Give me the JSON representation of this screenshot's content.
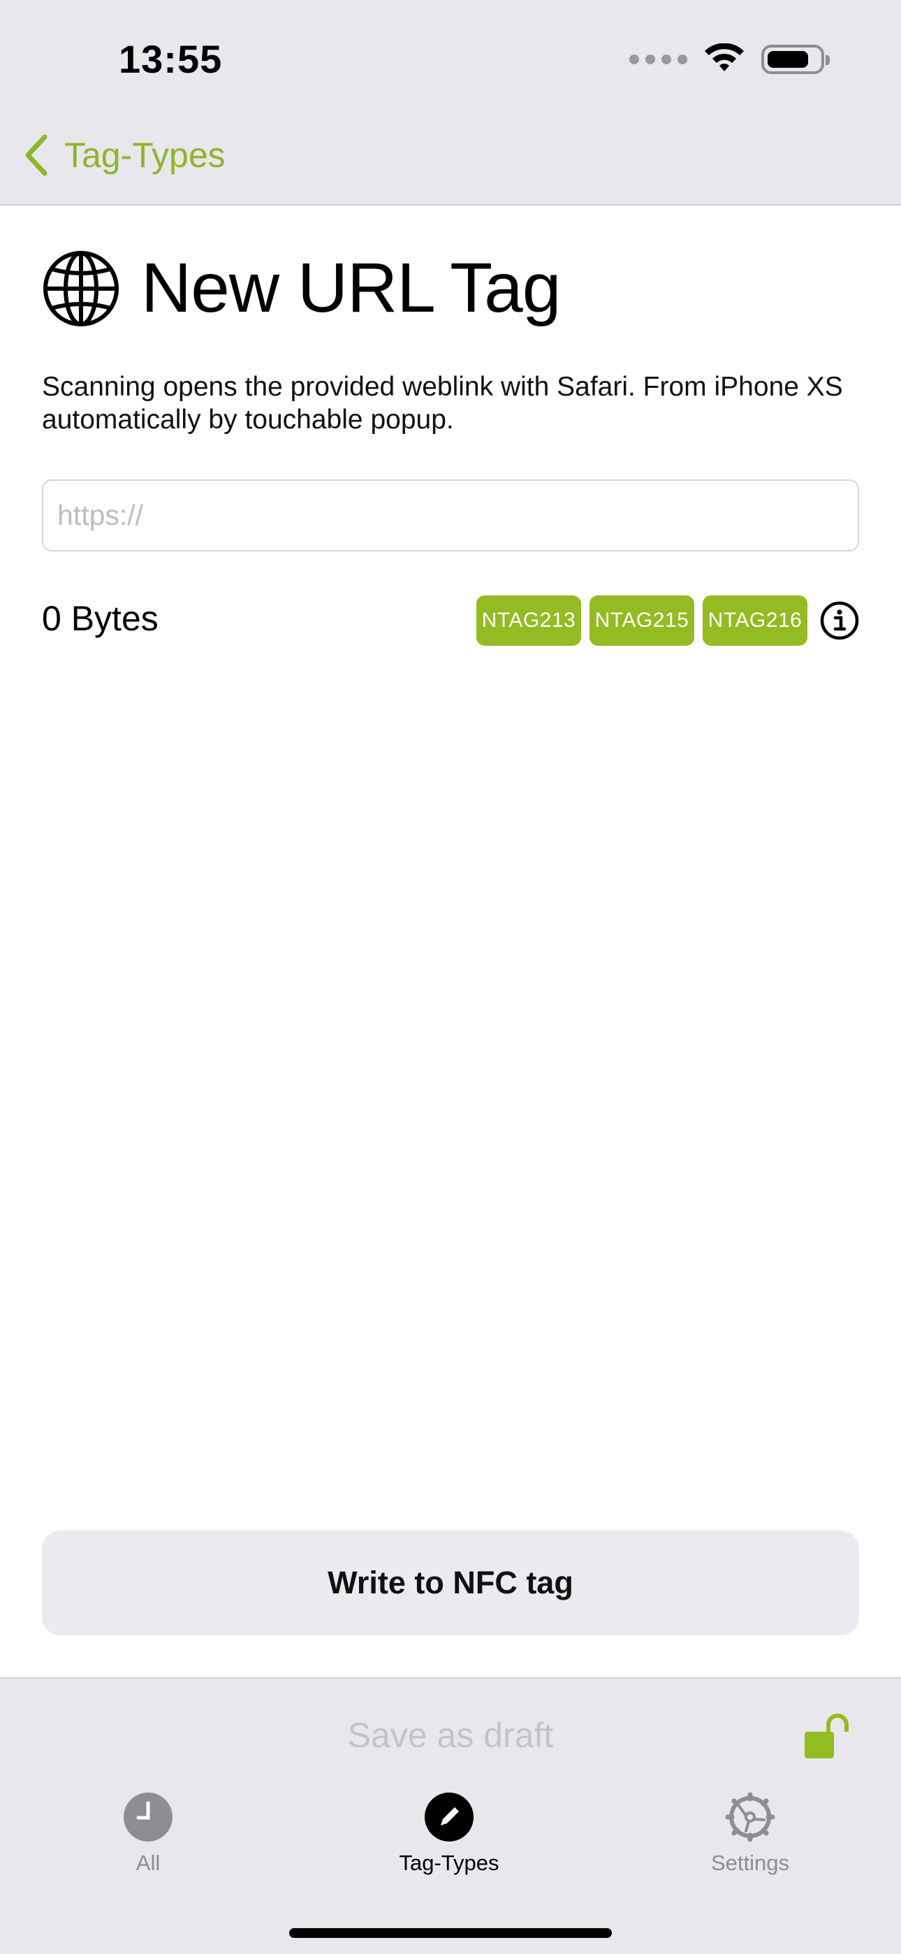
{
  "status_bar": {
    "time": "13:55"
  },
  "nav": {
    "back_label": "Tag-Types"
  },
  "header": {
    "title": "New URL Tag",
    "icon": "globe-icon",
    "description": "Scanning opens the provided weblink with Safari. From iPhone XS automatically by touchable popup."
  },
  "url_field": {
    "placeholder": "https://",
    "value": ""
  },
  "size": {
    "bytes_label": "0 Bytes"
  },
  "compatible_tags": [
    "NTAG213",
    "NTAG215",
    "NTAG216"
  ],
  "actions": {
    "write_label": "Write to NFC tag",
    "draft_label": "Save as draft"
  },
  "tabs": [
    {
      "label": "All",
      "icon": "clock-icon",
      "active": false
    },
    {
      "label": "Tag-Types",
      "icon": "pencil-icon",
      "active": true
    },
    {
      "label": "Settings",
      "icon": "gear-icon",
      "active": false
    }
  ],
  "colors": {
    "accent": "#93bb22",
    "chrome_background": "#e7e7ec",
    "inactive": "#8e8e92"
  }
}
